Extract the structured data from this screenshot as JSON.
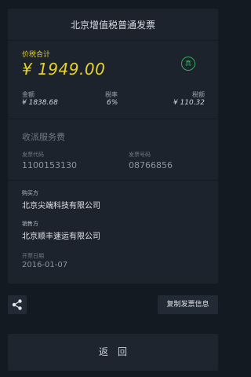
{
  "invoice": {
    "title": "北京增值税普通发票",
    "total_label": "价税合计",
    "total_amount": "¥ 1949.00",
    "authentic_badge": "真",
    "amount_label": "金额",
    "amount_value": "¥ 1838.68",
    "tax_rate_label": "税率",
    "tax_rate_value": "6%",
    "tax_label": "税额",
    "tax_value": "¥ 110.32",
    "service_type": "收派服务费",
    "invoice_code_label": "发票代码",
    "invoice_code": "1100153130",
    "invoice_number_label": "发票号码",
    "invoice_number": "08766856",
    "buyer_label": "购买方",
    "buyer": "北京尖端科技有限公司",
    "seller_label": "销售方",
    "seller": "北京顺丰速运有限公司",
    "date_label": "开票日期",
    "date": "2016-01-07"
  },
  "actions": {
    "share_icon": "share-icon",
    "copy_label": "复制发票信息",
    "back_label": "返回"
  },
  "colors": {
    "accent_yellow": "#e6d22b",
    "badge_green": "#2fae57",
    "background": "#141a22",
    "card": "#1c232d"
  }
}
